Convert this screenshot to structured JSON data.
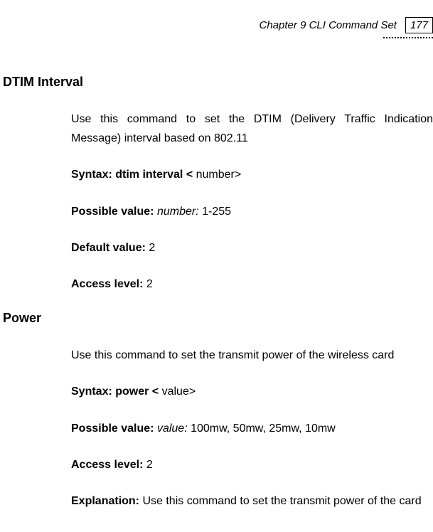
{
  "header": {
    "chapter": "Chapter 9 CLI Command Set",
    "page_number": "177"
  },
  "sections": {
    "dtim": {
      "heading": "DTIM Interval",
      "desc": "Use this command to set the DTIM (Delivery Traffic Indication Message) interval based on 802.11",
      "syntax_label": "Syntax: dtim interval < ",
      "syntax_arg": "number>",
      "possible_label": "Possible value: ",
      "possible_arg_ital": "number:",
      "possible_rest": " 1-255",
      "default_label": "Default value: ",
      "default_value": "2",
      "access_label": "Access level: ",
      "access_value": "2"
    },
    "power": {
      "heading": "Power",
      "desc": "Use this command to set the transmit power of the wireless card",
      "syntax_label": "Syntax: power < ",
      "syntax_arg": "value>",
      "possible_label": "Possible value: ",
      "possible_arg_ital": "value:",
      "possible_rest": "  100mw, 50mw, 25mw, 10mw",
      "access_label": "Access level: ",
      "access_value": "2",
      "explanation_label": "Explanation: ",
      "explanation_text": "Use this command to set the transmit power of the card"
    }
  }
}
